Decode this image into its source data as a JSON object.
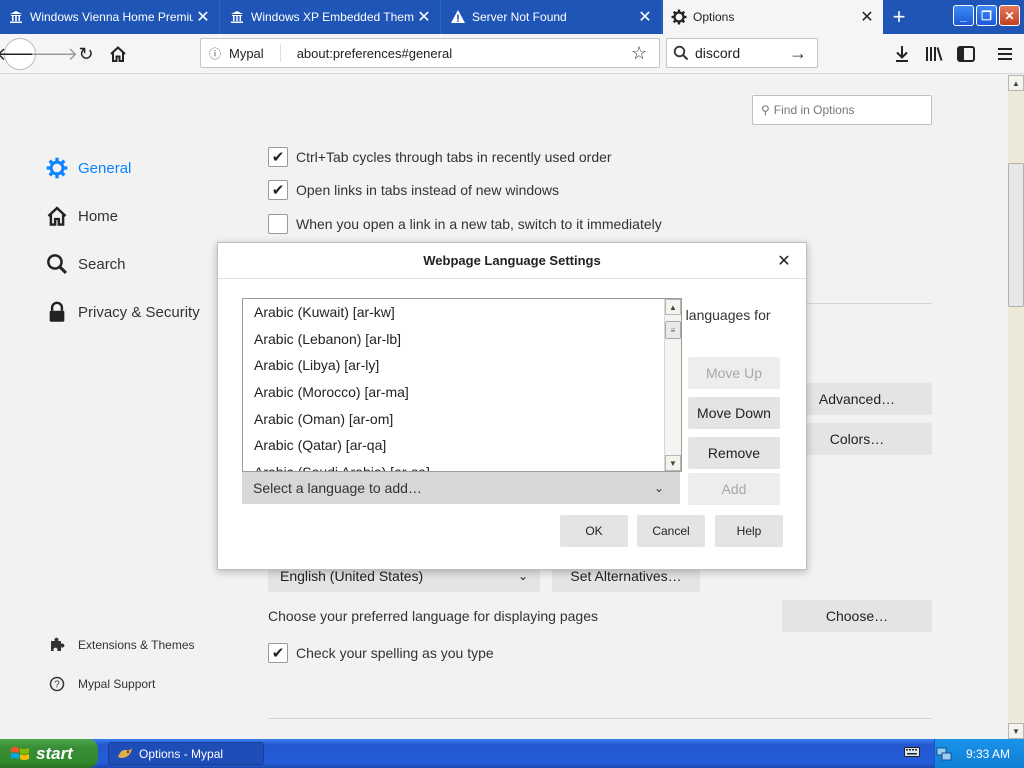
{
  "browser": {
    "tabs": [
      {
        "label": "Windows Vienna Home Premium",
        "icon": "museum-icon"
      },
      {
        "label": "Windows XP Embedded Theme",
        "icon": "museum-icon"
      },
      {
        "label": "Server Not Found",
        "icon": "warning-icon"
      },
      {
        "label": "Options",
        "icon": "gear-icon",
        "active": true
      }
    ],
    "new_tab_label": "+",
    "window_buttons": {
      "minimize": "_",
      "restore": "❐",
      "close": "✕"
    },
    "identity_label": "Mypal",
    "url": "about:preferences#general",
    "search_value": "discord"
  },
  "preferences": {
    "find_placeholder": "Find in Options",
    "sidebar": [
      {
        "label": "General",
        "icon": "gear-icon",
        "active": true
      },
      {
        "label": "Home",
        "icon": "home-icon"
      },
      {
        "label": "Search",
        "icon": "search-icon"
      },
      {
        "label": "Privacy & Security",
        "icon": "lock-icon"
      }
    ],
    "sidebar_footer": [
      {
        "label": "Extensions & Themes",
        "icon": "puzzle-icon"
      },
      {
        "label": "Mypal Support",
        "icon": "help-icon"
      }
    ],
    "checkboxes": [
      {
        "label": "Ctrl+Tab cycles through tabs in recently used order",
        "checked": true
      },
      {
        "label": "Open links in tabs instead of new windows",
        "checked": true
      },
      {
        "label": "When you open a link in a new tab, switch to it immediately",
        "checked": false
      }
    ],
    "advanced_button": "Advanced…",
    "colors_button": "Colors…",
    "locale_value": "English (United States)",
    "set_alternatives_button": "Set Alternatives…",
    "choose_language_text": "Choose your preferred language for displaying pages",
    "choose_button": "Choose…",
    "spelling_label": "Check your spelling as you type",
    "spelling_checked": true
  },
  "dialog": {
    "title": "Webpage Language Settings",
    "intro_fragment": "e languages for",
    "languages": [
      "Arabic (Kuwait) [ar-kw]",
      "Arabic (Lebanon) [ar-lb]",
      "Arabic (Libya) [ar-ly]",
      "Arabic (Morocco) [ar-ma]",
      "Arabic (Oman) [ar-om]",
      "Arabic (Qatar) [ar-qa]",
      "Arabic (Saudi Arabia) [ar-sa]"
    ],
    "move_up_label": "Move Up",
    "move_down_label": "Move Down",
    "remove_label": "Remove",
    "add_label": "Add",
    "select_placeholder": "Select a language to add…",
    "ok_label": "OK",
    "cancel_label": "Cancel",
    "help_label": "Help"
  },
  "taskbar": {
    "start_label": "start",
    "task_label": "Options - Mypal",
    "clock": "9:33 AM"
  },
  "colors": {
    "tabstrip": "#1f55b6",
    "accent": "#0a84ff",
    "taskbar": "#245dda",
    "start_green": "#3a8d37"
  }
}
